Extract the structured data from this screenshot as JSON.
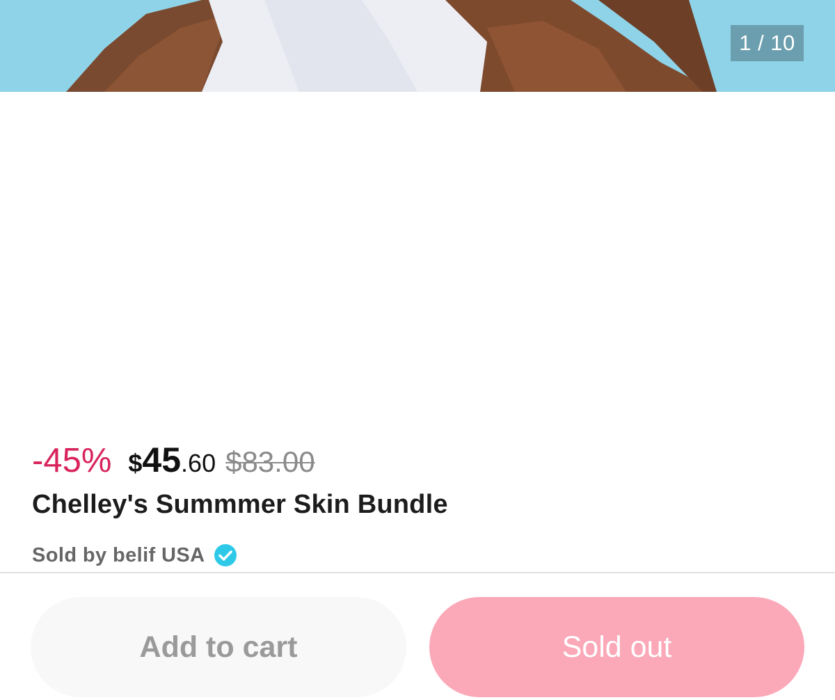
{
  "gallery": {
    "counter": "1 / 10"
  },
  "pricing": {
    "discount": "-45%",
    "currency": "$",
    "price_integer": "45",
    "price_decimal": ".60",
    "original_price": "$83.00"
  },
  "product": {
    "title": "Chelley's Summmer Skin Bundle"
  },
  "seller": {
    "label": "Sold by belif USA",
    "verified_icon": "verified-check-icon"
  },
  "actions": {
    "add_to_cart_label": "Add to cart",
    "sold_out_label": "Sold out"
  },
  "colors": {
    "discount": "#d8245c",
    "sold_out_button": "#fba8b8",
    "verified_badge": "#2ec9e8",
    "hero_background": "#8fd3e8"
  }
}
